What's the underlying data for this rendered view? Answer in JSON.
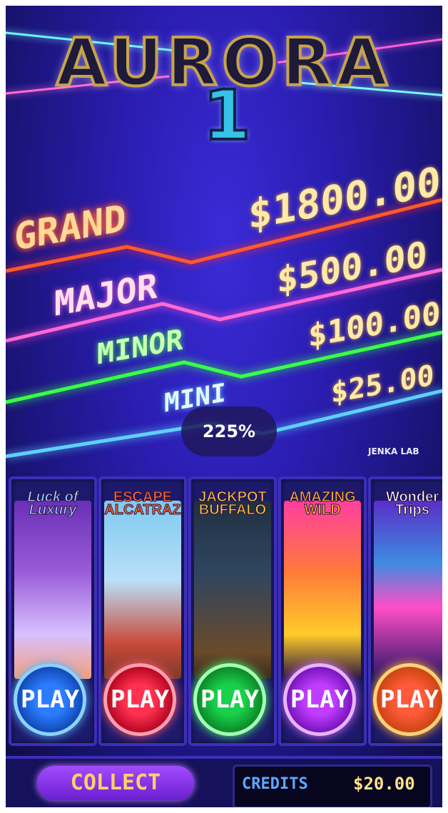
{
  "logo": {
    "title": "AURORA",
    "number": "1"
  },
  "jackpots": [
    {
      "label": "GRAND",
      "value": "$1800.00"
    },
    {
      "label": "MAJOR",
      "value": "$500.00"
    },
    {
      "label": "MINOR",
      "value": "$100.00"
    },
    {
      "label": "MINI",
      "value": "$25.00"
    }
  ],
  "zoom": "225%",
  "publisher": "JENKA LAB",
  "games": [
    {
      "title": "Luck of Luxury",
      "play_label": "PLAY"
    },
    {
      "title": "ESCAPE ALCATRAZ",
      "play_label": "PLAY"
    },
    {
      "title": "JACKPOT BUFFALO",
      "play_label": "PLAY"
    },
    {
      "title": "AMAZING WILD",
      "play_label": "PLAY"
    },
    {
      "title": "Wonder Trips",
      "play_label": "PLAY"
    }
  ],
  "bottom": {
    "collect_label": "COLLECT",
    "credits_label": "CREDITS",
    "credits_value": "$20.00"
  },
  "colors": {
    "grand": "#ff5a2a",
    "major": "#ff6ad5",
    "minor": "#39ff4a",
    "mini": "#5fd0ff",
    "accent": "#3d2fb6"
  }
}
